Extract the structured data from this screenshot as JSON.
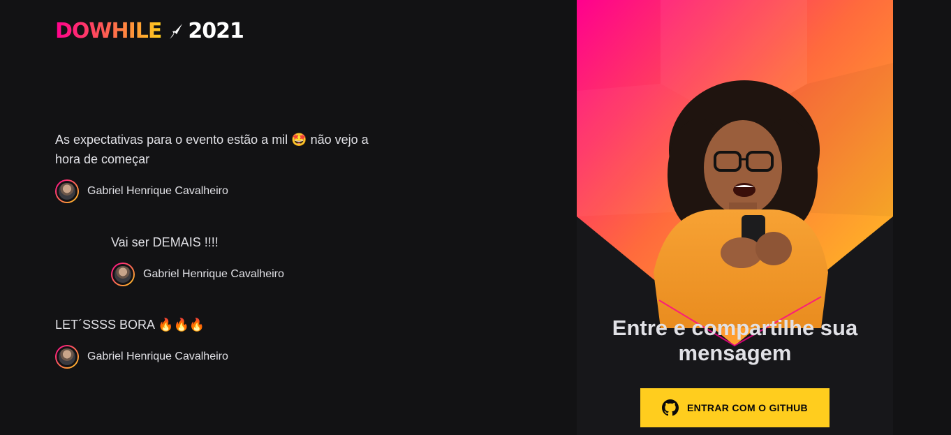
{
  "logo": {
    "text": "DOWHILE",
    "year": "2021",
    "icon": "rocket-icon"
  },
  "messages": [
    {
      "text": "As expectativas para o evento estão a mil 🤩 não vejo a hora de começar",
      "author": "Gabriel Henrique Cavalheiro"
    },
    {
      "text": "Vai ser DEMAIS !!!!",
      "author": "Gabriel Henrique Cavalheiro"
    },
    {
      "text": "LET´SSSS BORA 🔥🔥🔥",
      "author": "Gabriel Henrique Cavalheiro"
    }
  ],
  "login_panel": {
    "title": "Entre e compartilhe sua mensagem",
    "button_label": "ENTRAR COM O GITHUB",
    "button_icon": "github-icon"
  },
  "colors": {
    "background": "#121214",
    "panel": "#17171a",
    "accent_pink": "#ff008e",
    "accent_yellow": "#ffcd1e",
    "text": "#e1e1e6"
  }
}
